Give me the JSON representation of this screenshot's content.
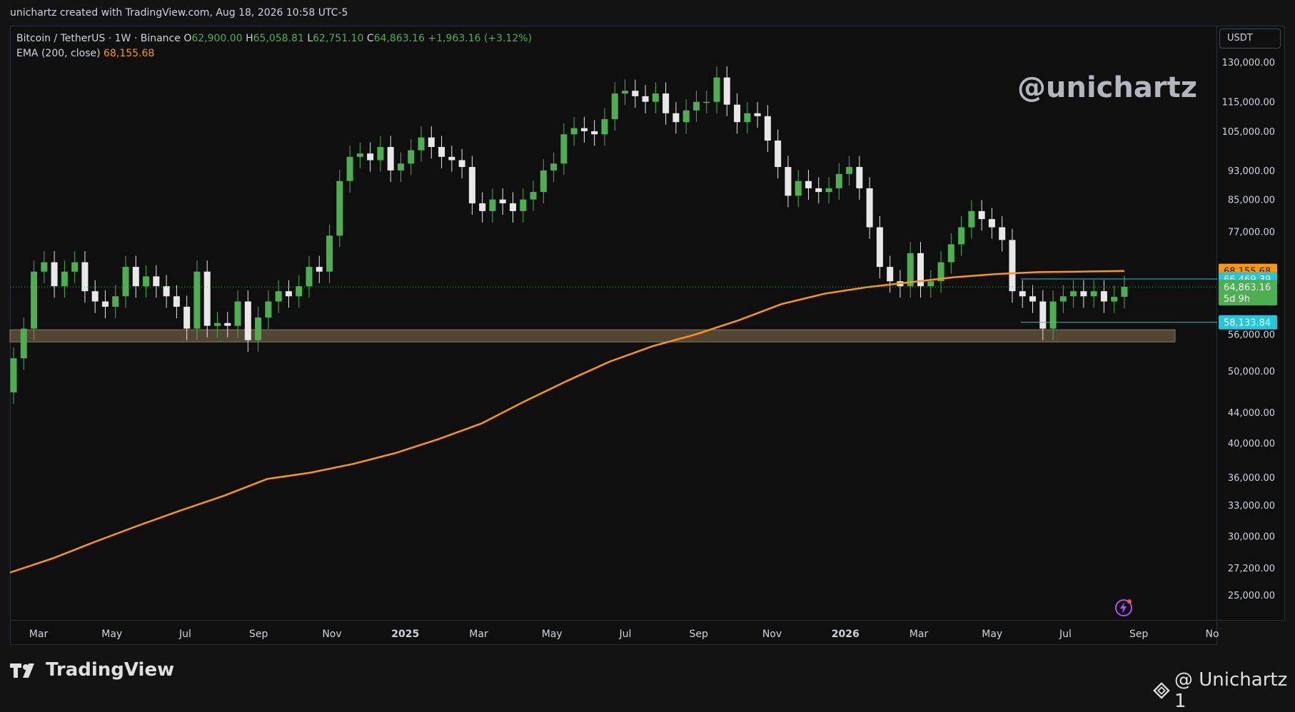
{
  "topbar": {
    "text": "unichartz created with TradingView.com, Aug 18, 2026 10:58 UTC-5"
  },
  "legend": {
    "symbol": "Bitcoin / TetherUS · 1W · Binance",
    "o_label": "O",
    "o_value": "62,900.00",
    "h_label": "H",
    "h_value": "65,058.81",
    "l_label": "L",
    "l_value": "62,751.10",
    "c_label": "C",
    "c_value": "64,863.16",
    "change": "+1,963.16 (+3.12%)",
    "ema_label": "EMA (200, close)",
    "ema_value": "68,155.68"
  },
  "currency": "USDT",
  "watermark": "@unichartz",
  "brand": {
    "name": "TradingView",
    "logo": "tradingview-logo-icon"
  },
  "footer_right": {
    "text": "@ Unichartz 1",
    "icon": "binance-diamond-icon"
  },
  "colors": {
    "up": "#4caf50",
    "down": "#e8e8e8",
    "ema": "#ff9800",
    "line_cyan": "#26c6da",
    "zone": "#6b5a43",
    "current": "#4caf50"
  },
  "chart_data": {
    "type": "candlestick",
    "interval": "1W",
    "y_scale": "log",
    "ylim": [
      23500,
      143000
    ],
    "x_ticks": [
      "Mar",
      "May",
      "Jul",
      "Sep",
      "Nov",
      "2025",
      "Mar",
      "May",
      "Jul",
      "Sep",
      "Nov",
      "2026",
      "Mar",
      "May",
      "Jul",
      "Sep",
      "No"
    ],
    "bold_x_ticks": [
      "2025",
      "2026"
    ],
    "y_ticks": [
      "130,000.00",
      "115,000.00",
      "105,000.00",
      "93,000.00",
      "85,000.00",
      "77,000.00",
      "56,000.00",
      "50,000.00",
      "44,000.00",
      "40,000.00",
      "36,000.00",
      "33,000.00",
      "30,000.00",
      "27,200.00",
      "25,000.00"
    ],
    "price_labels": [
      {
        "text": "68,155.68",
        "value": 68155.68,
        "kind": "ema"
      },
      {
        "text": "66,469.39",
        "value": 66469.39,
        "kind": "line"
      },
      {
        "text": "64,863.16",
        "value": 64863.16,
        "kind": "current",
        "sub": "5d 9h"
      },
      {
        "text": "58,133.84",
        "value": 58133.84,
        "kind": "line"
      }
    ],
    "support_zone": [
      54700,
      56800
    ],
    "series": [
      {
        "name": "Bitcoin / TetherUS",
        "kind": "weekly-close",
        "values": [
          52000,
          57000,
          68000,
          70000,
          65000,
          68000,
          70000,
          64000,
          62000,
          61000,
          63000,
          69000,
          65000,
          67000,
          65000,
          63000,
          61000,
          57000,
          68000,
          57500,
          58000,
          57500,
          62000,
          55000,
          59000,
          62000,
          64000,
          63000,
          65000,
          69000,
          68000,
          76000,
          90000,
          97000,
          98000,
          96000,
          100000,
          93000,
          95000,
          99000,
          103000,
          100000,
          97000,
          96000,
          94000,
          84000,
          82000,
          85000,
          84000,
          82000,
          85000,
          87000,
          93000,
          95000,
          104000,
          106000,
          105000,
          104000,
          109000,
          118000,
          119000,
          117000,
          115000,
          118000,
          111000,
          108000,
          112000,
          115000,
          115000,
          124000,
          114000,
          108000,
          111000,
          110000,
          102000,
          94000,
          86000,
          90000,
          88000,
          87000,
          88000,
          92000,
          94000,
          88000,
          78000,
          69000,
          66000,
          65000,
          72000,
          65000,
          66000,
          70000,
          74000,
          78000,
          82000,
          80000,
          78000,
          75000,
          64000,
          63000,
          62000,
          57000,
          62000,
          63000,
          64000,
          63000,
          64000,
          62000,
          62900,
          64863
        ]
      },
      {
        "name": "EMA (200, close)",
        "kind": "ema",
        "values": [
          26800,
          28000,
          29500,
          31000,
          32500,
          34000,
          35800,
          36500,
          37500,
          38800,
          40500,
          42500,
          45500,
          48500,
          51500,
          54000,
          56000,
          58500,
          61500,
          63500,
          64800,
          65800,
          66800,
          67500,
          67900,
          68000,
          68155
        ]
      }
    ]
  }
}
